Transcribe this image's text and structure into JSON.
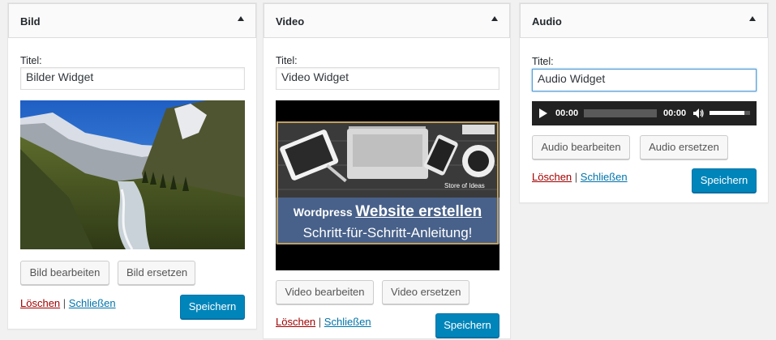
{
  "widgets": {
    "image": {
      "title": "Bild",
      "field_label": "Titel:",
      "input_value": "Bilder Widget",
      "edit_button": "Bild bearbeiten",
      "replace_button": "Bild ersetzen",
      "delete_link": "Löschen",
      "separator": "|",
      "close_link": "Schließen",
      "save_button": "Speichern"
    },
    "video": {
      "title": "Video",
      "field_label": "Titel:",
      "input_value": "Video Widget",
      "thumbnail": {
        "headline_prefix": "Wordpress",
        "headline_main": "Website erstellen",
        "subline": "Schritt-für-Schritt-Anleitung!",
        "brand": "Store of Ideas"
      },
      "edit_button": "Video bearbeiten",
      "replace_button": "Video ersetzen",
      "delete_link": "Löschen",
      "separator": "|",
      "close_link": "Schließen",
      "save_button": "Speichern"
    },
    "audio": {
      "title": "Audio",
      "field_label": "Titel:",
      "input_value": "Audio Widget",
      "player": {
        "current_time": "00:00",
        "duration": "00:00",
        "progress": 0,
        "volume": 0.85
      },
      "edit_button": "Audio bearbeiten",
      "replace_button": "Audio ersetzen",
      "delete_link": "Löschen",
      "separator": "|",
      "close_link": "Schließen",
      "save_button": "Speichern"
    }
  },
  "colors": {
    "primary": "#0085ba",
    "delete": "#a00000",
    "link": "#0073aa",
    "focus": "#5b9dd9"
  }
}
